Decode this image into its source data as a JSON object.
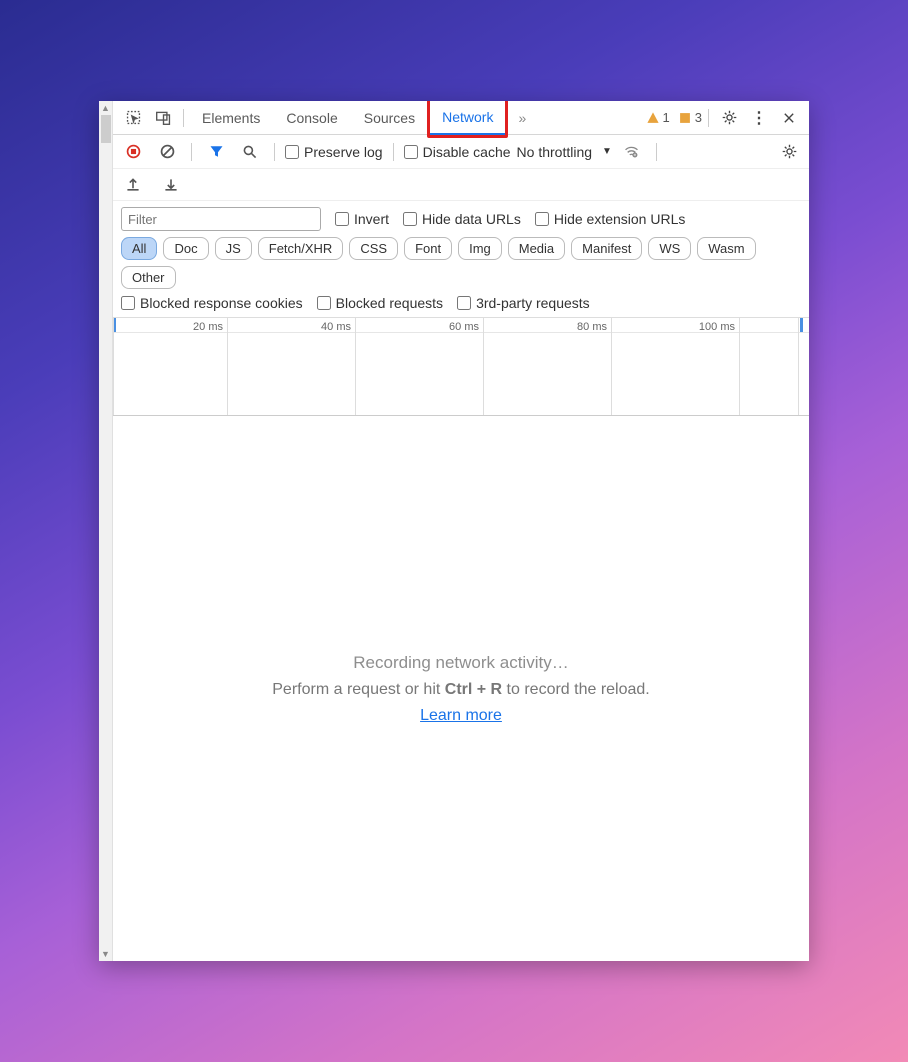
{
  "tabs": {
    "elements": "Elements",
    "console": "Console",
    "sources": "Sources",
    "network": "Network"
  },
  "warnings": {
    "count": "1"
  },
  "issues": {
    "count": "3"
  },
  "toolbar": {
    "preserve_log": "Preserve log",
    "disable_cache": "Disable cache",
    "throttling": "No throttling"
  },
  "filter": {
    "placeholder": "Filter",
    "invert": "Invert",
    "hide_data_urls": "Hide data URLs",
    "hide_ext_urls": "Hide extension URLs",
    "blocked_cookies": "Blocked response cookies",
    "blocked_requests": "Blocked requests",
    "third_party": "3rd-party requests"
  },
  "types": {
    "all": "All",
    "doc": "Doc",
    "js": "JS",
    "fetch": "Fetch/XHR",
    "css": "CSS",
    "font": "Font",
    "img": "Img",
    "media": "Media",
    "manifest": "Manifest",
    "ws": "WS",
    "wasm": "Wasm",
    "other": "Other"
  },
  "timeline": [
    "20 ms",
    "40 ms",
    "60 ms",
    "80 ms",
    "100 ms"
  ],
  "empty": {
    "l1": "Recording network activity…",
    "l2a": "Perform a request or hit ",
    "l2b": "Ctrl + R",
    "l2c": " to record the reload.",
    "learn": "Learn more"
  }
}
